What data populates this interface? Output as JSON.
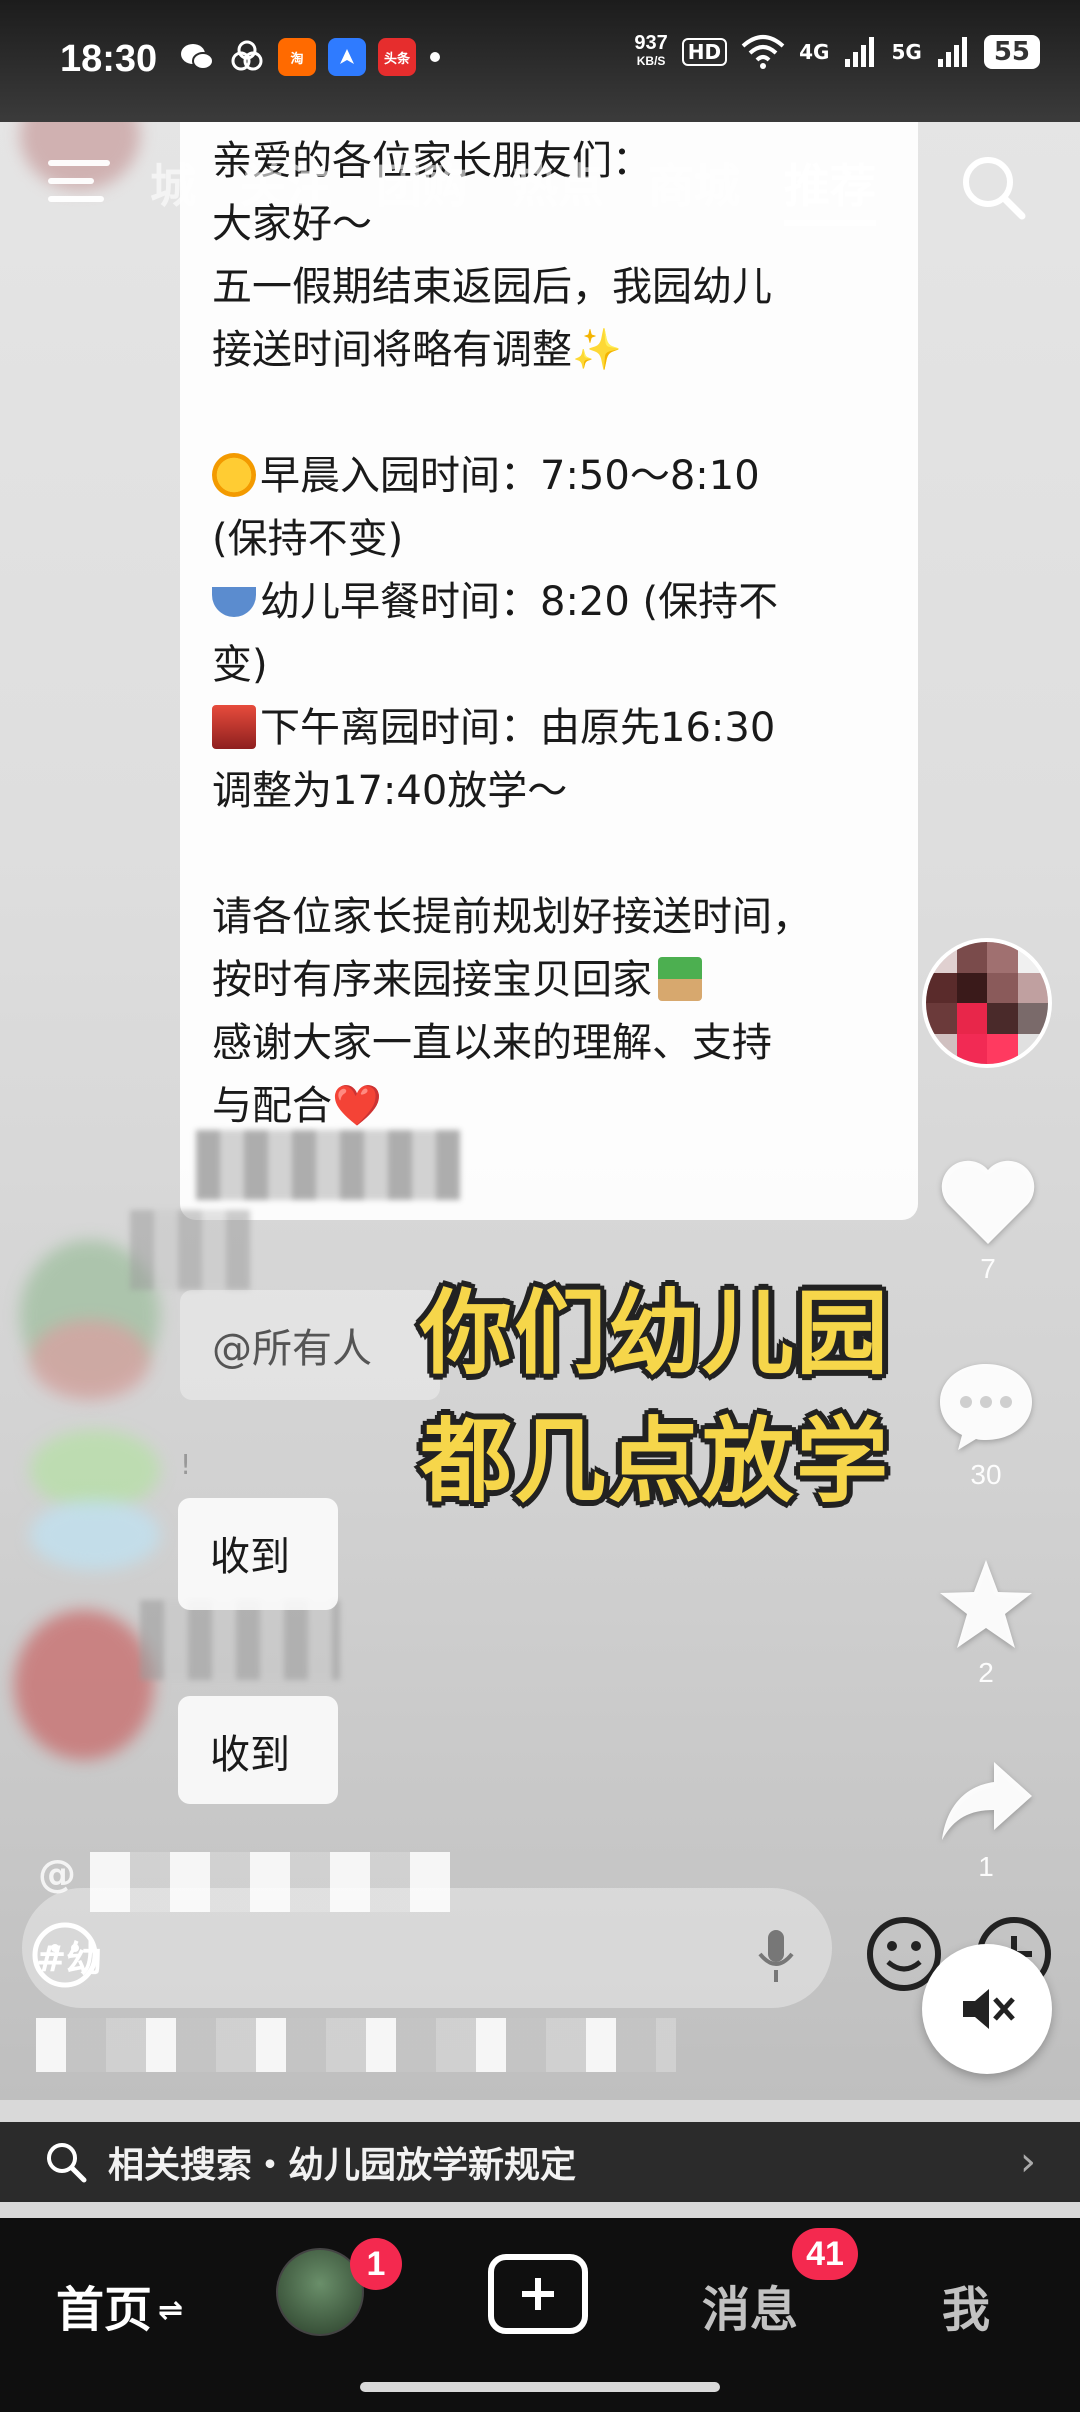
{
  "status_bar": {
    "time": "18:30",
    "net_speed_value": "937",
    "net_speed_unit": "KB/S",
    "hd_label": "HD",
    "net1": "4G",
    "net2": "5G",
    "battery": "55",
    "notif_icons": [
      "wechat-icon",
      "baidu-icon",
      "taobao-flash-icon",
      "navigation-icon",
      "toutiao-icon"
    ],
    "toutiao_label": "头条"
  },
  "top_tabs": {
    "items": [
      "城",
      "关注",
      "团购",
      "热点",
      "商城",
      "推荐"
    ],
    "active": "推荐"
  },
  "message": {
    "greeting": "亲爱的各位家长朋友们：",
    "hello": "大家好～",
    "line1": "五一假期结束返园后，我园幼儿",
    "line2": "接送时间将略有调整",
    "sparkle": "✨",
    "morning": "早晨入园时间：7:50～8:10",
    "morning_note": "(保持不变)",
    "breakfast": "幼儿早餐时间：8:20 (保持不",
    "breakfast_note": "变)",
    "afternoon": "下午离园时间：由原先16:30",
    "afternoon_note": "调整为17:40放学～",
    "plan1": "请各位家长提前规划好接送时间，",
    "plan2": "按时有序来园接宝贝回家",
    "thanks1": "感谢大家一直以来的理解、支持",
    "thanks2": "与配合",
    "heart": "❤️"
  },
  "chat_replies": {
    "mention": "@所有人",
    "received1": "收到",
    "received2": "收到",
    "excl": "!"
  },
  "overlay_caption": {
    "line1": "你们幼儿园",
    "line2": "都几点放学"
  },
  "actions": {
    "likes": "7",
    "comments": "30",
    "favorites": "2",
    "shares": "1"
  },
  "comment_overlay": {
    "handle_prefix": "@",
    "tag_prefix": "#幼"
  },
  "related_search": {
    "label": "相关搜索・幼儿园放学新规定"
  },
  "bottom_nav": {
    "home": "首页",
    "home_badge_swap": "⇌",
    "friends_badge": "1",
    "messages": "消息",
    "messages_badge": "41",
    "me": "我"
  }
}
